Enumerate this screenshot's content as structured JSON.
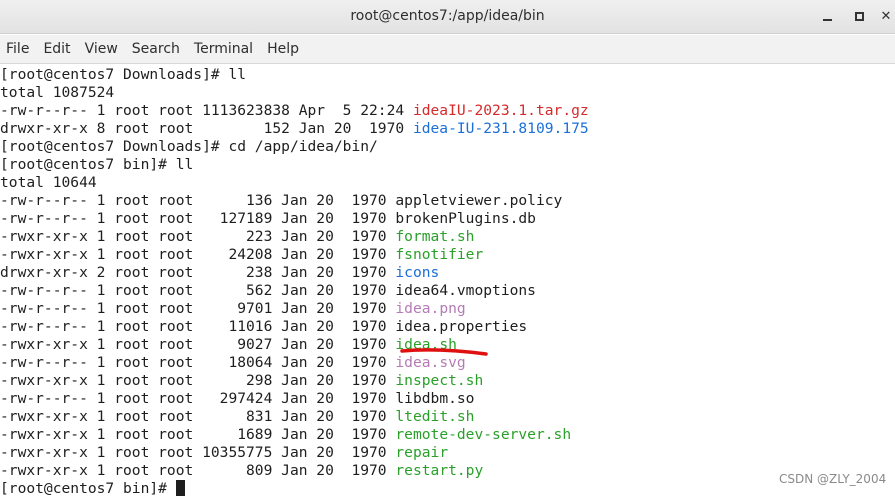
{
  "window": {
    "title": "root@centos7:/app/idea/bin",
    "minimize_icon": "minimize-icon",
    "maximize_icon": "maximize-icon",
    "close_icon": "close-icon",
    "close_glyph": "✕"
  },
  "menu": [
    "File",
    "Edit",
    "View",
    "Search",
    "Terminal",
    "Help"
  ],
  "colors": {
    "red": "#d62a2a",
    "blue": "#1a6fd8",
    "green": "#2aa02a",
    "magenta": "#b57bb5",
    "annotation": "#e01010"
  },
  "terminal": {
    "lines": [
      {
        "text": "[root@centos7 Downloads]# ll"
      },
      {
        "text": "total 1087524"
      },
      {
        "text": "-rw-r--r-- 1 root root 1113623838 Apr  5 22:24 ",
        "file": "ideaIU-2023.1.tar.gz",
        "color": "red"
      },
      {
        "text": "drwxr-xr-x 8 root root        152 Jan 20  1970 ",
        "file": "idea-IU-231.8109.175",
        "color": "blue"
      },
      {
        "text": "[root@centos7 Downloads]# cd /app/idea/bin/"
      },
      {
        "text": "[root@centos7 bin]# ll"
      },
      {
        "text": "total 10644"
      },
      {
        "text": "-rw-r--r-- 1 root root      136 Jan 20  1970 ",
        "file": "appletviewer.policy",
        "color": "default"
      },
      {
        "text": "-rw-r--r-- 1 root root   127189 Jan 20  1970 ",
        "file": "brokenPlugins.db",
        "color": "default"
      },
      {
        "text": "-rwxr-xr-x 1 root root      223 Jan 20  1970 ",
        "file": "format.sh",
        "color": "green"
      },
      {
        "text": "-rwxr-xr-x 1 root root    24208 Jan 20  1970 ",
        "file": "fsnotifier",
        "color": "green"
      },
      {
        "text": "drwxr-xr-x 2 root root      238 Jan 20  1970 ",
        "file": "icons",
        "color": "blue"
      },
      {
        "text": "-rw-r--r-- 1 root root      562 Jan 20  1970 ",
        "file": "idea64.vmoptions",
        "color": "default"
      },
      {
        "text": "-rw-r--r-- 1 root root     9701 Jan 20  1970 ",
        "file": "idea.png",
        "color": "magenta"
      },
      {
        "text": "-rw-r--r-- 1 root root    11016 Jan 20  1970 ",
        "file": "idea.properties",
        "color": "default"
      },
      {
        "text": "-rwxr-xr-x 1 root root     9027 Jan 20  1970 ",
        "file": "idea.sh",
        "color": "green"
      },
      {
        "text": "-rw-r--r-- 1 root root    18064 Jan 20  1970 ",
        "file": "idea.svg",
        "color": "magenta"
      },
      {
        "text": "-rwxr-xr-x 1 root root      298 Jan 20  1970 ",
        "file": "inspect.sh",
        "color": "green"
      },
      {
        "text": "-rw-r--r-- 1 root root   297424 Jan 20  1970 ",
        "file": "libdbm.so",
        "color": "default"
      },
      {
        "text": "-rwxr-xr-x 1 root root      831 Jan 20  1970 ",
        "file": "ltedit.sh",
        "color": "green"
      },
      {
        "text": "-rwxr-xr-x 1 root root     1689 Jan 20  1970 ",
        "file": "remote-dev-server.sh",
        "color": "green"
      },
      {
        "text": "-rwxr-xr-x 1 root root 10355775 Jan 20  1970 ",
        "file": "repair",
        "color": "green"
      },
      {
        "text": "-rwxr-xr-x 1 root root      809 Jan 20  1970 ",
        "file": "restart.py",
        "color": "green"
      },
      {
        "text": "[root@centos7 bin]# ",
        "cursor": true
      }
    ]
  },
  "watermark": "CSDN @ZLY_2004"
}
